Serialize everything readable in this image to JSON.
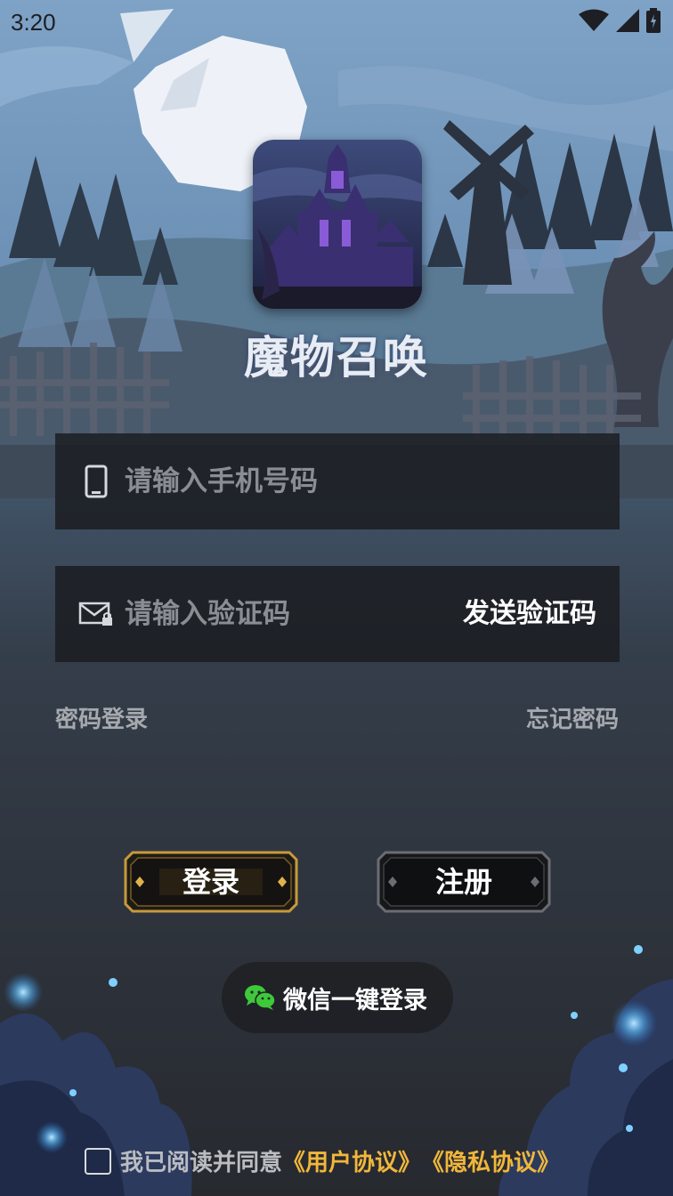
{
  "status_bar": {
    "time": "3:20"
  },
  "app": {
    "title": "魔物召唤"
  },
  "phone_field": {
    "placeholder": "请输入手机号码"
  },
  "code_field": {
    "placeholder": "请输入验证码",
    "send_label": "发送验证码"
  },
  "links": {
    "password_login": "密码登录",
    "forgot_password": "忘记密码"
  },
  "buttons": {
    "login": "登录",
    "register": "注册"
  },
  "wechat": {
    "label": "微信一键登录"
  },
  "agreement": {
    "prefix": "我已阅读并同意",
    "user_agreement": "《用户协议》",
    "privacy_agreement": "《隐私协议》"
  },
  "colors": {
    "accent_gold": "#f1b73b",
    "wechat_green": "#3ec93b",
    "field_bg": "#1a1b1f"
  },
  "icons": {
    "phone": "phone-icon",
    "mail": "mail-lock-icon",
    "wechat": "wechat-icon",
    "wifi": "wifi-icon",
    "signal": "signal-icon",
    "battery": "battery-icon"
  }
}
